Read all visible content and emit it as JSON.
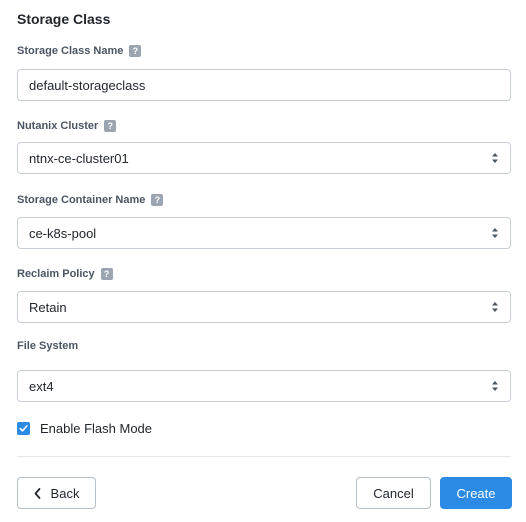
{
  "section": {
    "title": "Storage Class"
  },
  "fields": {
    "storage_class_name": {
      "label": "Storage Class Name",
      "value": "default-storageclass",
      "help": "?"
    },
    "nutanix_cluster": {
      "label": "Nutanix Cluster",
      "value": "ntnx-ce-cluster01",
      "help": "?"
    },
    "storage_container_name": {
      "label": "Storage Container Name",
      "value": "ce-k8s-pool",
      "help": "?"
    },
    "reclaim_policy": {
      "label": "Reclaim Policy",
      "value": "Retain",
      "help": "?"
    },
    "file_system": {
      "label": "File System",
      "value": "ext4"
    }
  },
  "flash_mode": {
    "label": "Enable Flash Mode",
    "checked": true
  },
  "footer": {
    "back_label": "Back",
    "cancel_label": "Cancel",
    "create_label": "Create"
  },
  "colors": {
    "primary": "#2a8ae4",
    "help_icon": "#9aa5b1",
    "border": "#c8ced6"
  }
}
